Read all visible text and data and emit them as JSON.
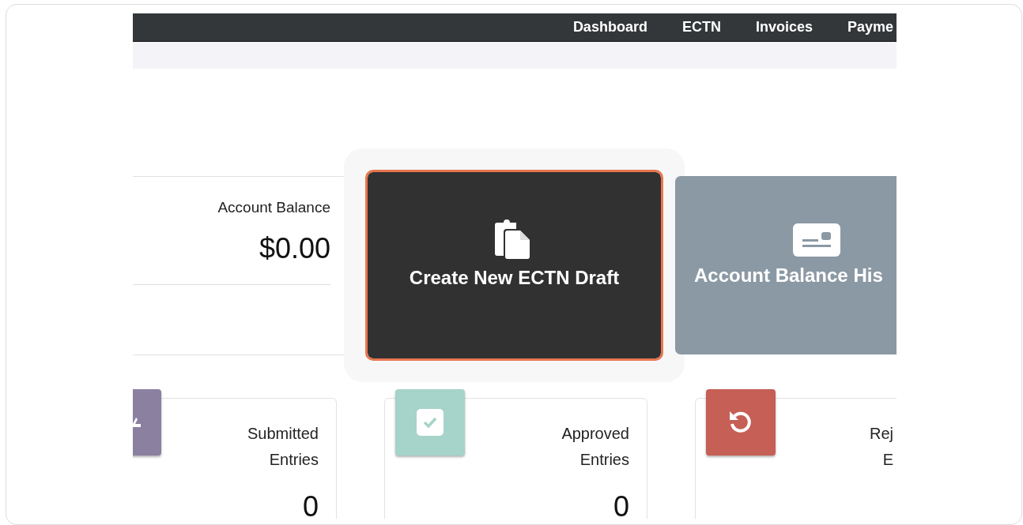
{
  "nav": {
    "items": [
      {
        "label": "Dashboard"
      },
      {
        "label": "ECTN"
      },
      {
        "label": "Invoices"
      },
      {
        "label": "Payme"
      }
    ]
  },
  "balance": {
    "label": "Account Balance",
    "amount": "$0.00"
  },
  "actions": [
    {
      "kind": "create",
      "label": "Create New ECTN Draft",
      "highlighted": true
    },
    {
      "kind": "history",
      "label": "Account Balance His",
      "highlighted": false
    }
  ],
  "stats": [
    {
      "kind": "submitted",
      "color": "#8b80a0",
      "lines": [
        "Submitted",
        "Entries"
      ],
      "value": "0"
    },
    {
      "kind": "approved",
      "color": "#a6d3ca",
      "lines": [
        "Approved",
        "Entries"
      ],
      "value": "0"
    },
    {
      "kind": "rejected",
      "color": "#c65f55",
      "lines": [
        "Rej",
        "E"
      ]
    }
  ]
}
